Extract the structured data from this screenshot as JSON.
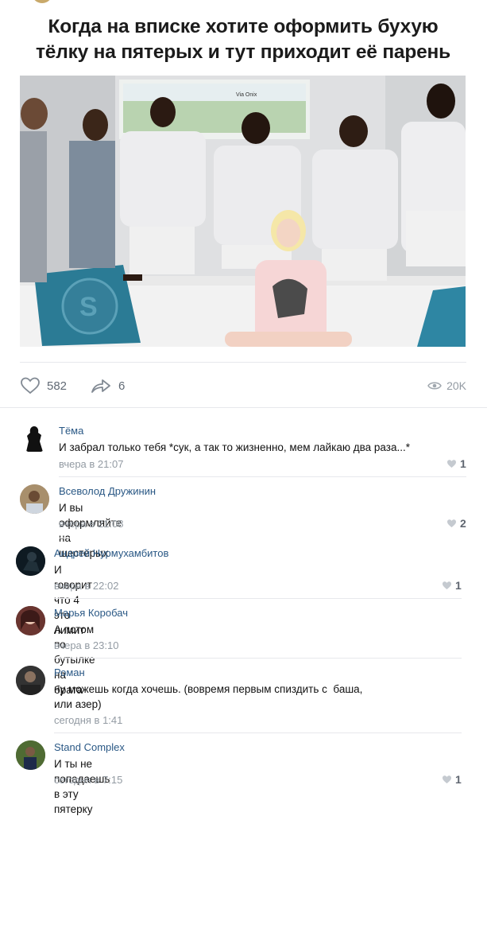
{
  "post": {
    "title_line1": "Когда на вписке хотите оформить бухую",
    "title_line2": "тёлку на пятерых и тут приходит её парень",
    "image_watermark": "Via Onix",
    "likes": "582",
    "shares": "6",
    "views": "20K"
  },
  "comments": [
    {
      "author": "Тёма",
      "text": "И забрал только тебя *сук, а так то жизненно, мем лайкаю два раза...*",
      "time": "вчера в 21:07",
      "likes": "1"
    },
    {
      "author": "Всеволод Дружинин",
      "text": "И вы оформляйте на шестерых",
      "time": "вчера в 21:08",
      "likes": "2"
    },
    {
      "author": "Андрей Нурмухамбитов",
      "text": "И говорит что 4 это лимит",
      "time": "вчера в 22:02",
      "likes": "1"
    },
    {
      "author": "Марья Коробач",
      "text": "А потом по бутылке на брата",
      "time": "вчера в 23:10",
      "likes": ""
    },
    {
      "author": "Роман",
      "text_line1": "ну можешь когда хочешь. (вовремя первым спиздить с  баша,",
      "text_line2": "или азер)",
      "time": "сегодня в 1:41",
      "likes": ""
    },
    {
      "author": "Stand Complex",
      "text": "И ты не попадаешь в эту пятерку",
      "time": "сегодня в 7:15",
      "likes": "1"
    }
  ],
  "colors": {
    "link": "#2a5885",
    "meta": "#939ba3",
    "divider": "#e7e8ec"
  }
}
